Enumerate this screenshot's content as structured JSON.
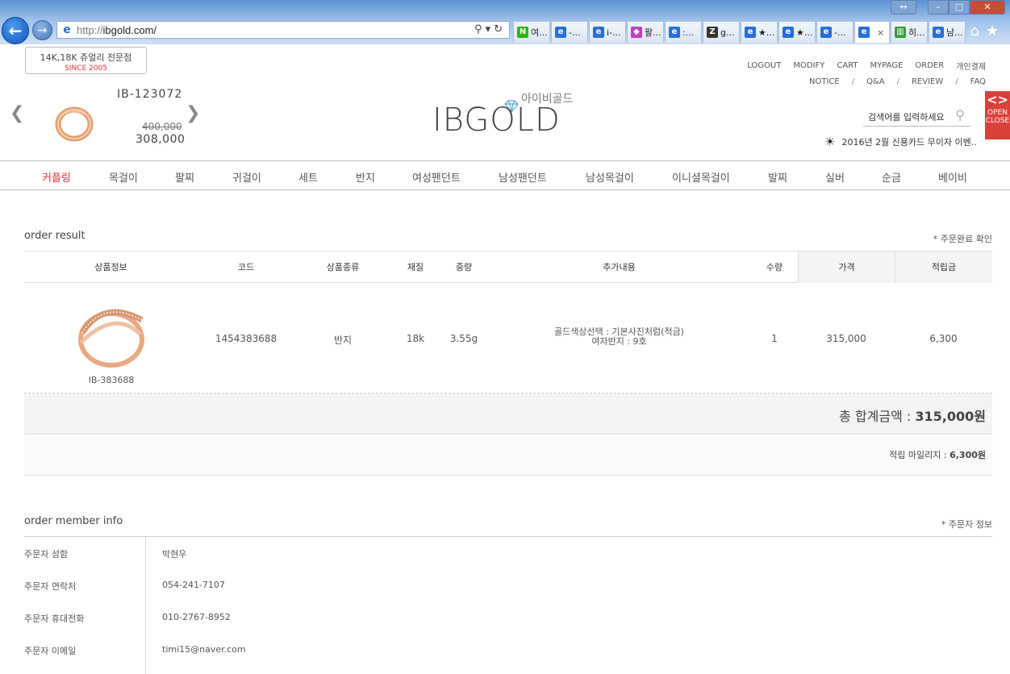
{
  "browser": {
    "url_protocol": "http://",
    "url_host": "ibgold.com/",
    "tabs": [
      {
        "icon": "naver-icon",
        "label": "여...",
        "color": "#2db400",
        "glyph": "N"
      },
      {
        "icon": "ie-page-icon",
        "label": "-...",
        "color": "#2a6fd6",
        "glyph": "e"
      },
      {
        "icon": "ie-page-icon",
        "label": "i-...",
        "color": "#2a6fd6",
        "glyph": "e"
      },
      {
        "icon": "gem-icon",
        "label": "팔...",
        "color": "#c040c0",
        "glyph": "◆"
      },
      {
        "icon": "ie-page-icon",
        "label": ":...",
        "color": "#2a6fd6",
        "glyph": "e"
      },
      {
        "icon": "z-site-icon",
        "label": "g...",
        "color": "#333333",
        "glyph": "Z"
      },
      {
        "icon": "ie-page-icon",
        "label": "★...",
        "color": "#2a6fd6",
        "glyph": "e"
      },
      {
        "icon": "ie-page-icon",
        "label": "★...",
        "color": "#2a6fd6",
        "glyph": "e"
      },
      {
        "icon": "ie-page-icon",
        "label": "-...",
        "color": "#2a6fd6",
        "glyph": "e"
      },
      {
        "icon": "ie-page-icon",
        "label": "",
        "color": "#2a6fd6",
        "glyph": "e",
        "active": true
      },
      {
        "icon": "chart-icon",
        "label": "히...",
        "color": "#3a9a3a",
        "glyph": "▥"
      },
      {
        "icon": "ie-page-icon",
        "label": "남...",
        "color": "#2a6fd6",
        "glyph": "e"
      }
    ]
  },
  "header": {
    "badge_line1": "14K,18K 쥬얼리 전문점",
    "badge_line2": "SINCE 2005",
    "promo": {
      "code": "IB-123072",
      "old_price": "400,000",
      "price": "308,000"
    },
    "logo_kor": "아이비골드",
    "logo_en": "IBGOLD",
    "top_menu_row1": [
      "LOGOUT",
      "MODIFY",
      "CART",
      "MYPAGE",
      "ORDER",
      "개인결제"
    ],
    "top_menu_row2": [
      "NOTICE",
      "Q&A",
      "REVIEW",
      "FAQ"
    ],
    "search_placeholder": "검색어를 입력하세요",
    "side_tab": [
      "OPEN",
      "CLOSE"
    ],
    "notice_text": "2016년 2월 신용카드 무이자 이벤..",
    "nav": [
      "커플링",
      "목걸이",
      "팔찌",
      "귀걸이",
      "세트",
      "반지",
      "여성팬던트",
      "남성팬던트",
      "남성목걸이",
      "이니셜목걸이",
      "발찌",
      "실버",
      "순금",
      "베이비"
    ],
    "nav_active_color": "#dd3333"
  },
  "order_result": {
    "title": "order result",
    "note": "* 주문완료 확인",
    "columns": [
      "상품정보",
      "코드",
      "상품종류",
      "재질",
      "중량",
      "추가내용",
      "수량",
      "가격",
      "적립금"
    ],
    "item": {
      "product_code": "IB-383688",
      "code": "1454383688",
      "type": "반지",
      "material": "18k",
      "weight": "3.55g",
      "option1": "골드색상선택 : 기본사진처럼(적금)",
      "option2": "여자반지 : 9호",
      "qty": "1",
      "price": "315,000",
      "points": "6,300"
    },
    "total_label": "총 합계금액 : ",
    "total_value": "315,000원",
    "mileage_label": "적립 마일리지 : ",
    "mileage_value": "6,300원"
  },
  "member_info": {
    "title": "order member info",
    "note": "* 주문자 정보",
    "rows": [
      {
        "label": "주문자 성함",
        "value": "박현우"
      },
      {
        "label": "주문자 연락처",
        "value": "054-241-7107"
      },
      {
        "label": "주문자 휴대전화",
        "value": "010-2767-8952"
      },
      {
        "label": "주문자 이메일",
        "value": "timi15@naver.com"
      }
    ]
  }
}
